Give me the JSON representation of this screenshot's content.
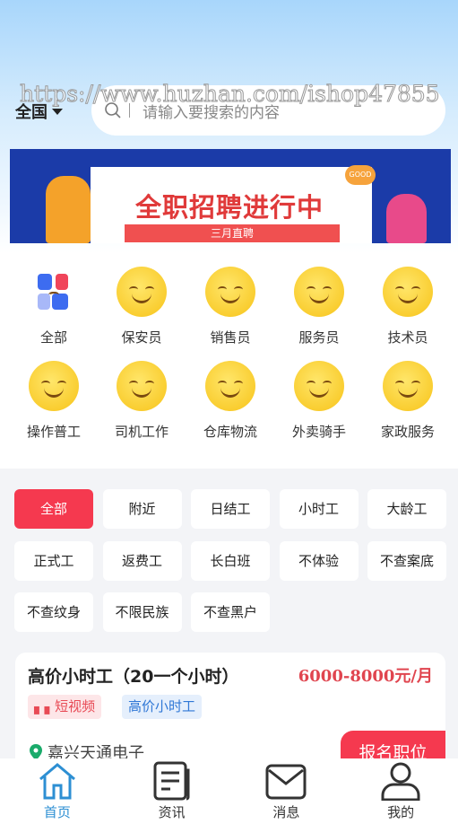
{
  "watermark": "https://www.huzhan.com/ishop47855",
  "header": {
    "location": "全国",
    "search_placeholder": "请输入要搜索的内容"
  },
  "banner": {
    "title": "全职招聘进行中",
    "subtitle": "三月直聘",
    "badge": "GOOD"
  },
  "categories": [
    {
      "label": "全部",
      "icon": "grid-icon"
    },
    {
      "label": "保安员",
      "icon": "smiley-icon"
    },
    {
      "label": "销售员",
      "icon": "smiley-icon"
    },
    {
      "label": "服务员",
      "icon": "smiley-icon"
    },
    {
      "label": "技术员",
      "icon": "smiley-icon"
    },
    {
      "label": "操作普工",
      "icon": "smiley-icon"
    },
    {
      "label": "司机工作",
      "icon": "smiley-icon"
    },
    {
      "label": "仓库物流",
      "icon": "smiley-icon"
    },
    {
      "label": "外卖骑手",
      "icon": "smiley-icon"
    },
    {
      "label": "家政服务",
      "icon": "smiley-icon"
    }
  ],
  "filters": [
    "全部",
    "附近",
    "日结工",
    "小时工",
    "大龄工",
    "正式工",
    "返费工",
    "长白班",
    "不体验",
    "不查案底",
    "不查纹身",
    "不限民族",
    "不查黑户"
  ],
  "active_filter": "全部",
  "job": {
    "title": "高价小时工（20一个小时）",
    "salary": "6000-8000元/月",
    "tags": [
      "短视频",
      "高价小时工"
    ],
    "company": "嘉兴天通电子",
    "apply": "报名职位"
  },
  "nav": [
    {
      "label": "首页",
      "icon": "home-icon",
      "active": true
    },
    {
      "label": "资讯",
      "icon": "news-icon"
    },
    {
      "label": "消息",
      "icon": "mail-icon"
    },
    {
      "label": "我的",
      "icon": "user-icon"
    }
  ],
  "colors": {
    "accent": "#f5394f",
    "nav_active": "#2d8fd3",
    "salary": "#e0454f"
  }
}
